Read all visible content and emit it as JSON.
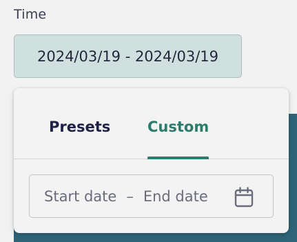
{
  "field": {
    "label": "Time"
  },
  "range_button": {
    "value": "2024/03/19 - 2024/03/19"
  },
  "popover": {
    "tabs": [
      {
        "label": "Presets",
        "active": false
      },
      {
        "label": "Custom",
        "active": true
      }
    ],
    "date_input": {
      "start_placeholder": "Start date",
      "separator": "–",
      "end_placeholder": "End date",
      "icon": "calendar-icon"
    }
  },
  "colors": {
    "accent": "#2e7a6c",
    "range_button_bg": "#d0e0df",
    "backdrop": "#2f6479"
  }
}
